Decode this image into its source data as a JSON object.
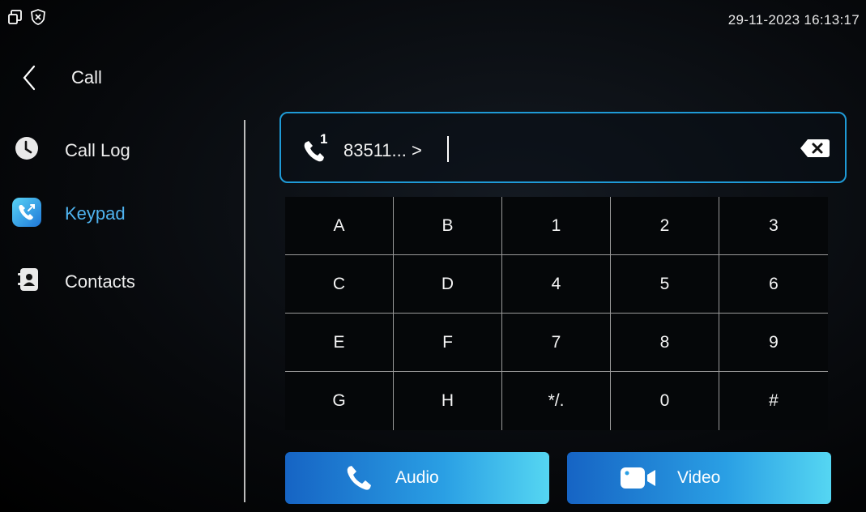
{
  "status_bar": {
    "icons": [
      "window-restore-icon",
      "close-circle-icon"
    ],
    "datetime": "29-11-2023 16:13:17"
  },
  "header": {
    "back_icon": "chevron-left-icon",
    "title": "Call"
  },
  "sidebar": {
    "items": [
      {
        "label": "Call Log",
        "icon": "clock-icon",
        "active": false
      },
      {
        "label": "Keypad",
        "icon": "phone-keypad-icon",
        "active": true
      },
      {
        "label": "Contacts",
        "icon": "contacts-book-icon",
        "active": false
      }
    ]
  },
  "dial_input": {
    "line_number": "1",
    "value": "83511... >",
    "backspace_icon": "backspace-icon"
  },
  "keypad": {
    "keys": [
      [
        "A",
        "B",
        "1",
        "2",
        "3"
      ],
      [
        "C",
        "D",
        "4",
        "5",
        "6"
      ],
      [
        "E",
        "F",
        "7",
        "8",
        "9"
      ],
      [
        "G",
        "H",
        "*/.",
        "0",
        "#"
      ]
    ]
  },
  "actions": {
    "audio_label": "Audio",
    "video_label": "Video"
  },
  "colors": {
    "accent": "#1f9ad6",
    "active_text": "#4fb3ef",
    "button_gradient_start": "#1664c4",
    "button_gradient_end": "#55d6f2"
  }
}
